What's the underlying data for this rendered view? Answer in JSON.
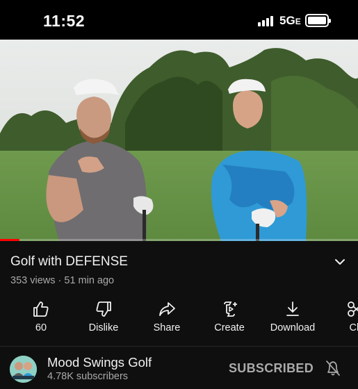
{
  "status_bar": {
    "time": "11:52",
    "network": "5G",
    "network_suffix": "E",
    "battery_level": 0.95
  },
  "video": {
    "progress_fraction": 0.055,
    "player_icon": "video-frame"
  },
  "title_section": {
    "title": "Golf with DEFENSE",
    "views": "353 views",
    "separator": " · ",
    "age": "51 min ago",
    "expand_icon": "chevron-down-icon"
  },
  "actions": [
    {
      "label": "60",
      "icon": "thumbs-up-icon"
    },
    {
      "label": "Dislike",
      "icon": "thumbs-down-icon"
    },
    {
      "label": "Share",
      "icon": "share-icon"
    },
    {
      "label": "Create",
      "icon": "create-icon"
    },
    {
      "label": "Download",
      "icon": "download-icon"
    },
    {
      "label": "Cli",
      "icon": "clip-icon"
    }
  ],
  "channel": {
    "name": "Mood Swings Golf",
    "subscribers": "4.78K subscribers",
    "subscribe_label": "SUBSCRIBED",
    "bell_icon": "bell-off-icon"
  },
  "colors": {
    "background": "#0f0f0f",
    "progress": "#ff0000",
    "secondary_text": "#aaaaaa"
  }
}
